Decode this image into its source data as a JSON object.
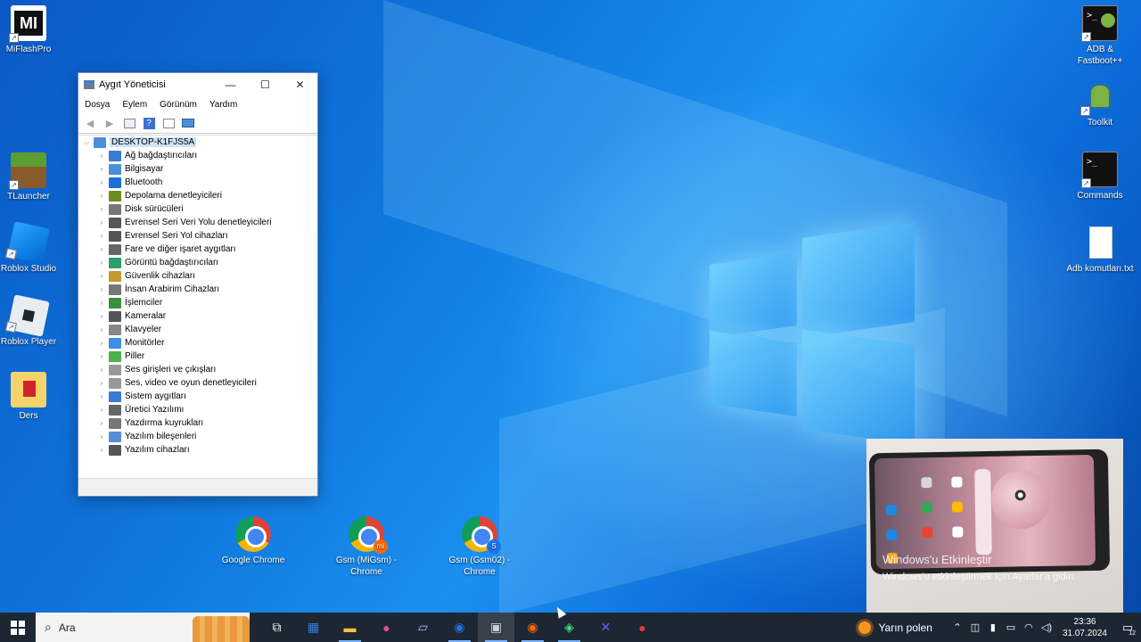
{
  "desktop": {
    "icons_left": [
      {
        "label": "MiFlashPro",
        "icon": "miflash-icon"
      },
      {
        "label": "TLauncher",
        "icon": "minecraft-icon"
      },
      {
        "label": "Roblox Studio",
        "icon": "roblox-studio-icon"
      },
      {
        "label": "Roblox Player",
        "icon": "roblox-player-icon"
      },
      {
        "label": "Ders",
        "icon": "folder-icon"
      }
    ],
    "icons_right": [
      {
        "label": "ADB & Fastboot++",
        "icon": "terminal-icon"
      },
      {
        "label": "Toolkit",
        "icon": "android-icon"
      },
      {
        "label": "Commands",
        "icon": "terminal-icon"
      },
      {
        "label": "Adb komutları.txt",
        "icon": "text-file-icon"
      }
    ],
    "icons_bottom": [
      {
        "label": "Google Chrome",
        "badge": ""
      },
      {
        "label": "Gsm (MiGsm) - Chrome",
        "badge": "mi",
        "badge_color": "#ff6700"
      },
      {
        "label": "Gsm (Gsm02) - Chrome",
        "badge": "S",
        "badge_color": "#1a73e8"
      }
    ]
  },
  "window": {
    "title": "Aygıt Yöneticisi",
    "controls": {
      "minimize": "—",
      "maximize": "☐",
      "close": "✕"
    },
    "menu": [
      "Dosya",
      "Eylem",
      "Görünüm",
      "Yardım"
    ],
    "toolbar": [
      "back-icon",
      "forward-icon",
      "properties-icon",
      "help-icon",
      "view-icon",
      "monitor-icon"
    ],
    "tree": {
      "root": "DESKTOP-K1FJS5A",
      "children": [
        {
          "label": "Ağ bağdaştırıcıları",
          "color": "#3a7bd5"
        },
        {
          "label": "Bilgisayar",
          "color": "#4a90d9"
        },
        {
          "label": "Bluetooth",
          "color": "#1e6fd9"
        },
        {
          "label": "Depolama denetleyicileri",
          "color": "#6b8e23"
        },
        {
          "label": "Disk sürücüleri",
          "color": "#777777"
        },
        {
          "label": "Evrensel Seri Veri Yolu denetleyicileri",
          "color": "#555555"
        },
        {
          "label": "Evrensel Seri Yol cihazları",
          "color": "#555555"
        },
        {
          "label": "Fare ve diğer işaret aygıtları",
          "color": "#666666"
        },
        {
          "label": "Görüntü bağdaştırıcıları",
          "color": "#2e9e6a"
        },
        {
          "label": "Güvenlik cihazları",
          "color": "#c49a2c"
        },
        {
          "label": "İnsan Arabirim Cihazları",
          "color": "#777777"
        },
        {
          "label": "İşlemciler",
          "color": "#3c8f3c"
        },
        {
          "label": "Kameralar",
          "color": "#555555"
        },
        {
          "label": "Klavyeler",
          "color": "#888888"
        },
        {
          "label": "Monitörler",
          "color": "#3a8ee6"
        },
        {
          "label": "Piller",
          "color": "#4caf50"
        },
        {
          "label": "Ses girişleri ve çıkışları",
          "color": "#999999"
        },
        {
          "label": "Ses, video ve oyun denetleyicileri",
          "color": "#999999"
        },
        {
          "label": "Sistem aygıtları",
          "color": "#3a7bd5"
        },
        {
          "label": "Üretici Yazılımı",
          "color": "#666666"
        },
        {
          "label": "Yazdırma kuyrukları",
          "color": "#777777"
        },
        {
          "label": "Yazılım bileşenleri",
          "color": "#5b8dd6"
        },
        {
          "label": "Yazılım cihazları",
          "color": "#555555"
        }
      ]
    }
  },
  "overlay": {
    "activation_title": "Windows'u Etkinleştir",
    "activation_text": "Windows'u etkinleştirmek için Ayarlar'a gidin."
  },
  "taskbar": {
    "search_placeholder": "Ara",
    "apps": [
      {
        "name": "task-view-icon",
        "glyph": "⧉",
        "state": ""
      },
      {
        "name": "store-icon",
        "glyph": "▦",
        "state": ""
      },
      {
        "name": "file-explorer-icon",
        "glyph": "▬",
        "state": "open"
      },
      {
        "name": "drop-app-icon",
        "glyph": "●",
        "state": ""
      },
      {
        "name": "notepad-icon",
        "glyph": "▱",
        "state": ""
      },
      {
        "name": "chrome-gsm02-icon",
        "glyph": "◉",
        "state": "open"
      },
      {
        "name": "device-manager-icon",
        "glyph": "▣",
        "state": "active"
      },
      {
        "name": "chrome-migsm-icon",
        "glyph": "◉",
        "state": "open"
      },
      {
        "name": "android-studio-icon",
        "glyph": "◈",
        "state": "open"
      },
      {
        "name": "kotlin-app-icon",
        "glyph": "✕",
        "state": ""
      },
      {
        "name": "record-icon",
        "glyph": "●",
        "state": ""
      }
    ],
    "weather": "Yarın polen",
    "time": "23:36",
    "date": "31.07.2024",
    "notifications": "12"
  }
}
